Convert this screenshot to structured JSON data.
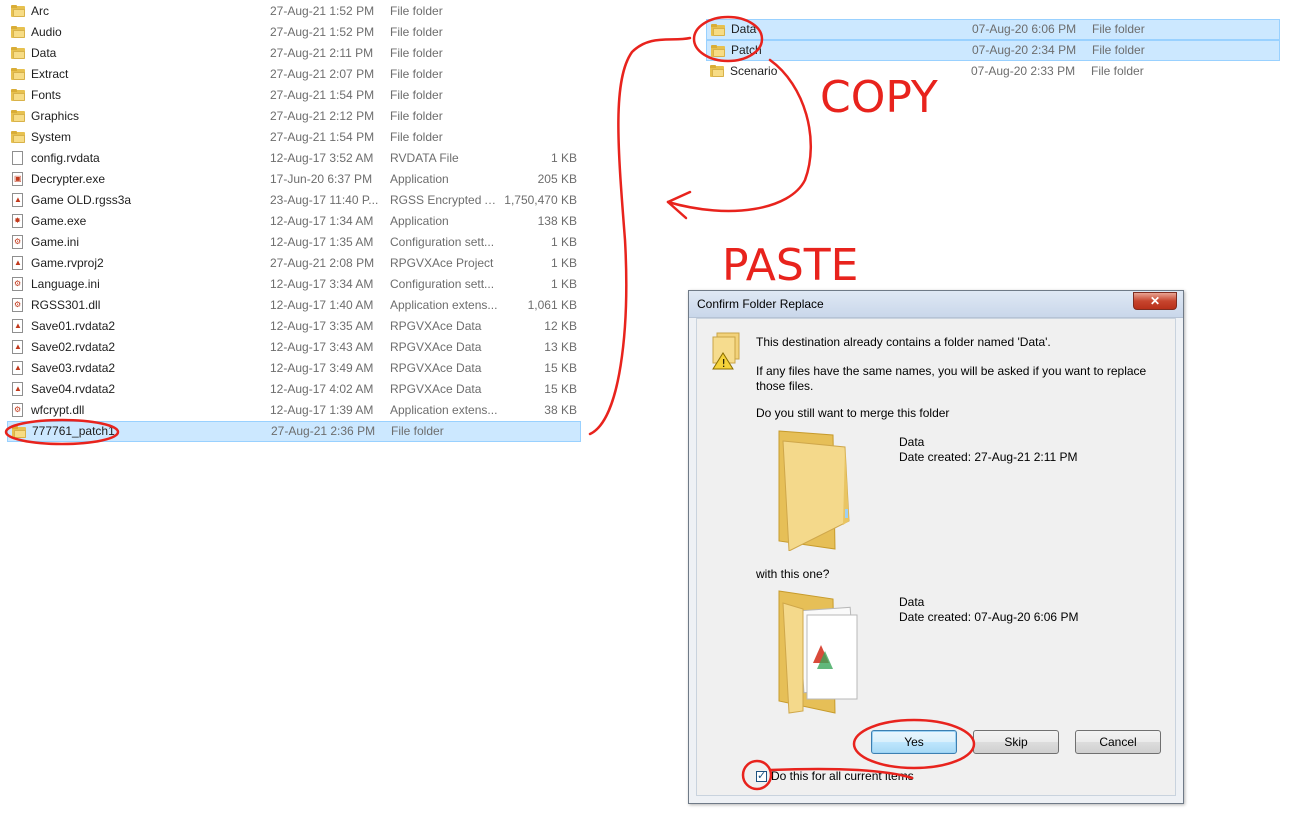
{
  "left_list": {
    "rows": [
      {
        "name": "Arc",
        "date": "27-Aug-21 1:52 PM",
        "type": "File folder",
        "size": "",
        "icon": "folder-icon"
      },
      {
        "name": "Audio",
        "date": "27-Aug-21 1:52 PM",
        "type": "File folder",
        "size": "",
        "icon": "folder-icon"
      },
      {
        "name": "Data",
        "date": "27-Aug-21 2:11 PM",
        "type": "File folder",
        "size": "",
        "icon": "folder-icon"
      },
      {
        "name": "Extract",
        "date": "27-Aug-21 2:07 PM",
        "type": "File folder",
        "size": "",
        "icon": "folder-icon"
      },
      {
        "name": "Fonts",
        "date": "27-Aug-21 1:54 PM",
        "type": "File folder",
        "size": "",
        "icon": "folder-icon"
      },
      {
        "name": "Graphics",
        "date": "27-Aug-21 2:12 PM",
        "type": "File folder",
        "size": "",
        "icon": "folder-icon"
      },
      {
        "name": "System",
        "date": "27-Aug-21 1:54 PM",
        "type": "File folder",
        "size": "",
        "icon": "folder-icon"
      },
      {
        "name": "config.rvdata",
        "date": "12-Aug-17 3:52 AM",
        "type": "RVDATA File",
        "size": "1 KB",
        "icon": "file-icon"
      },
      {
        "name": "Decrypter.exe",
        "date": "17-Jun-20 6:37 PM",
        "type": "Application",
        "size": "205 KB",
        "icon": "application-icon"
      },
      {
        "name": "Game OLD.rgss3a",
        "date": "23-Aug-17 11:40 P...",
        "type": "RGSS Encrypted A...",
        "size": "1,750,470 KB",
        "icon": "data-file-icon"
      },
      {
        "name": "Game.exe",
        "date": "12-Aug-17 1:34 AM",
        "type": "Application",
        "size": "138 KB",
        "icon": "game-exe-icon"
      },
      {
        "name": "Game.ini",
        "date": "12-Aug-17 1:35 AM",
        "type": "Configuration sett...",
        "size": "1 KB",
        "icon": "settings-file-icon"
      },
      {
        "name": "Game.rvproj2",
        "date": "27-Aug-21 2:08 PM",
        "type": "RPGVXAce Project",
        "size": "1 KB",
        "icon": "data-file-icon"
      },
      {
        "name": "Language.ini",
        "date": "12-Aug-17 3:34 AM",
        "type": "Configuration sett...",
        "size": "1 KB",
        "icon": "settings-file-icon"
      },
      {
        "name": "RGSS301.dll",
        "date": "12-Aug-17 1:40 AM",
        "type": "Application extens...",
        "size": "1,061 KB",
        "icon": "dll-file-icon"
      },
      {
        "name": "Save01.rvdata2",
        "date": "12-Aug-17 3:35 AM",
        "type": "RPGVXAce Data",
        "size": "12 KB",
        "icon": "data-file-icon"
      },
      {
        "name": "Save02.rvdata2",
        "date": "12-Aug-17 3:43 AM",
        "type": "RPGVXAce Data",
        "size": "13 KB",
        "icon": "data-file-icon"
      },
      {
        "name": "Save03.rvdata2",
        "date": "12-Aug-17 3:49 AM",
        "type": "RPGVXAce Data",
        "size": "15 KB",
        "icon": "data-file-icon"
      },
      {
        "name": "Save04.rvdata2",
        "date": "12-Aug-17 4:02 AM",
        "type": "RPGVXAce Data",
        "size": "15 KB",
        "icon": "data-file-icon"
      },
      {
        "name": "wfcrypt.dll",
        "date": "12-Aug-17 1:39 AM",
        "type": "Application extens...",
        "size": "38 KB",
        "icon": "dll-file-icon"
      },
      {
        "name": "777761_patch1",
        "date": "27-Aug-21 2:36 PM",
        "type": "File folder",
        "size": "",
        "icon": "folder-icon",
        "selected": true
      }
    ]
  },
  "right_list": {
    "rows": [
      {
        "name": "Data",
        "date": "07-Aug-20 6:06 PM",
        "type": "File folder",
        "icon": "folder-icon",
        "selected": true
      },
      {
        "name": "Patch",
        "date": "07-Aug-20 2:34 PM",
        "type": "File folder",
        "icon": "folder-icon",
        "selected": true
      },
      {
        "name": "Scenario",
        "date": "07-Aug-20 2:33 PM",
        "type": "File folder",
        "icon": "folder-icon",
        "selected": false
      }
    ]
  },
  "annotations": {
    "copy": "COPY",
    "paste": "PASTE",
    "color": "#e8231d"
  },
  "dialog": {
    "title": "Confirm Folder Replace",
    "close_glyph": "✕",
    "line1": "This destination already contains a folder named 'Data'.",
    "line2a": "If any files have the same names, you will be asked if you want to replace",
    "line2b": "those files.",
    "line3": "Do you still want to merge this folder",
    "existing": {
      "name": "Data",
      "date": "Date created: 27-Aug-21 2:11 PM"
    },
    "with_text": "with this one?",
    "incoming": {
      "name": "Data",
      "date": "Date created: 07-Aug-20 6:06 PM"
    },
    "yes": "Yes",
    "skip": "Skip",
    "cancel": "Cancel",
    "checkbox_label": "Do this for all current items",
    "checkbox_checked": true
  }
}
